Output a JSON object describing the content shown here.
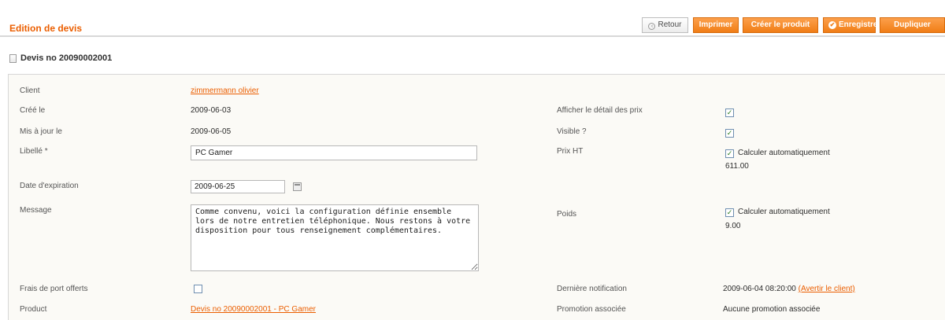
{
  "header": {
    "title": "Edition de devis",
    "buttons": {
      "back": "Retour",
      "print": "Imprimer",
      "create_product": "Créer le produit",
      "save": "Enregistrer",
      "duplicate": "Dupliquer"
    }
  },
  "section": {
    "title": "Devis no 20090002001"
  },
  "icons": {
    "back": "circle-arrow-icon",
    "save": "check-circle-icon",
    "section": "document-icon",
    "calendar": "calendar-icon",
    "checkbox": "checkmark-icon"
  },
  "colors": {
    "accent": "#eb5e00",
    "button": "#f07d16",
    "panel": "#fbfaf6"
  },
  "form": {
    "client": {
      "label": "Client",
      "value": "zimmermann olivier"
    },
    "created": {
      "label": "Créé le",
      "value": "2009-06-03"
    },
    "updated": {
      "label": "Mis à jour le",
      "value": "2009-06-05"
    },
    "libelle": {
      "label": "Libellé *",
      "value": "PC Gamer"
    },
    "expiration": {
      "label": "Date d'expiration",
      "value": "2009-06-25"
    },
    "message": {
      "label": "Message",
      "value": "Comme convenu, voici la configuration définie ensemble lors de notre entretien téléphonique. Nous restons à votre disposition pour tous renseignement complémentaires."
    },
    "free_shipping": {
      "label": "Frais de port offerts",
      "checked": false
    },
    "product": {
      "label": "Product",
      "value": "Devis no 20090002001 - PC Gamer"
    },
    "show_price_detail": {
      "label": "Afficher le détail des prix",
      "checked": true
    },
    "visible": {
      "label": "Visible ?",
      "checked": true
    },
    "price_ht": {
      "label": "Prix HT",
      "auto_label": "Calculer automatiquement",
      "auto_checked": true,
      "value": "611.00"
    },
    "weight": {
      "label": "Poids",
      "auto_label": "Calculer automatiquement",
      "auto_checked": true,
      "value": "9.00"
    },
    "last_notification": {
      "label": "Dernière notification",
      "value": "2009-06-04 08:20:00",
      "link": "(Avertir le client)"
    },
    "promotion": {
      "label": "Promotion associée",
      "value": "Aucune promotion associée"
    }
  }
}
